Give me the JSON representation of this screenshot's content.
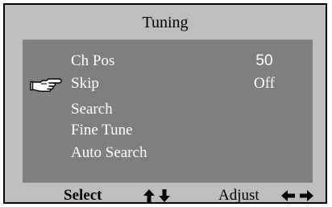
{
  "menu": {
    "title": "Tuning",
    "items": [
      {
        "label": "Ch Pos",
        "value": "50",
        "selected": false
      },
      {
        "label": "Skip",
        "value": "Off",
        "selected": true
      },
      {
        "label": "Search",
        "value": "",
        "selected": false
      },
      {
        "label": "Fine Tune",
        "value": "",
        "selected": false
      },
      {
        "label": "Auto Search",
        "value": "",
        "selected": false
      }
    ]
  },
  "footer": {
    "select_label": "Select",
    "select_icon": "up-down-arrows-icon",
    "adjust_label": "Adjust",
    "adjust_icon": "left-right-arrows-icon"
  },
  "colors": {
    "frame_background": "#bebebe",
    "panel_background": "#7f7f7f",
    "menu_text": "#ffffff",
    "footer_text": "#000000"
  }
}
